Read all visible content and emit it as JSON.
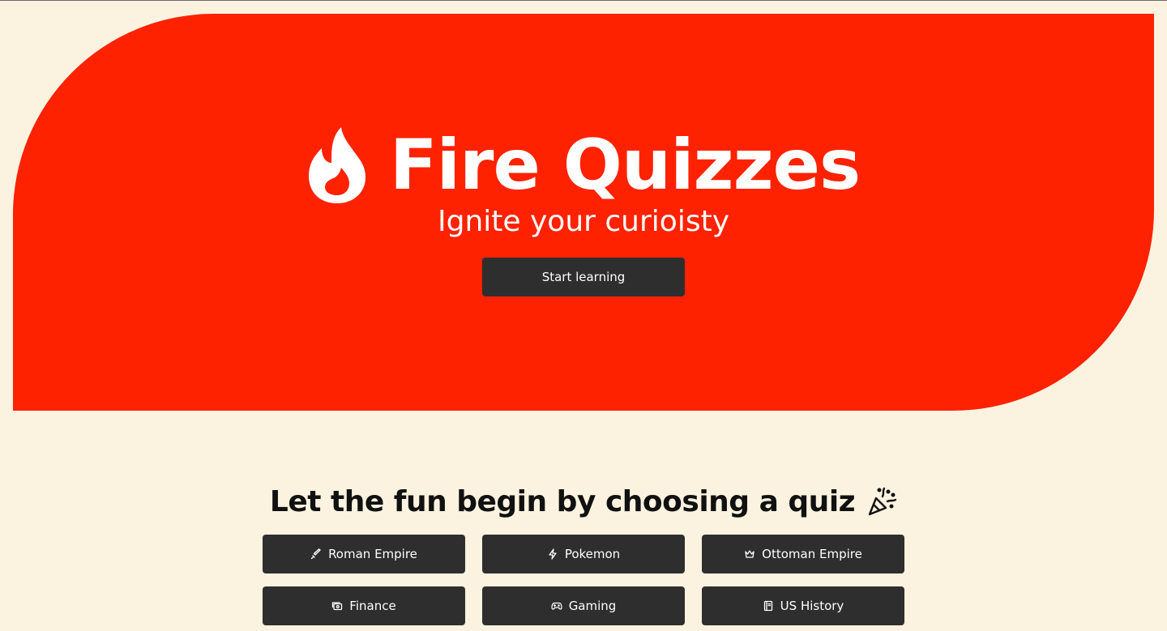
{
  "hero": {
    "title": "Fire Quizzes",
    "subtitle": "Ignite your curioisty",
    "start_button_label": "Start learning",
    "background_color": "#FF2200",
    "logo_icon": "flame-icon"
  },
  "quiz_section": {
    "title": "Let the fun begin by choosing a quiz",
    "title_icon": "party-popper-icon",
    "quizzes": [
      {
        "label": "Roman Empire",
        "icon": "sword-icon"
      },
      {
        "label": "Pokemon",
        "icon": "lightning-icon"
      },
      {
        "label": "Ottoman Empire",
        "icon": "crown-icon"
      },
      {
        "label": "Finance",
        "icon": "cash-icon"
      },
      {
        "label": "Gaming",
        "icon": "gamepad-icon"
      },
      {
        "label": "US History",
        "icon": "book-icon"
      }
    ]
  },
  "colors": {
    "page_background": "#FBF3E0",
    "button_background": "#2E2E2E",
    "button_text": "#FFFFFF"
  }
}
